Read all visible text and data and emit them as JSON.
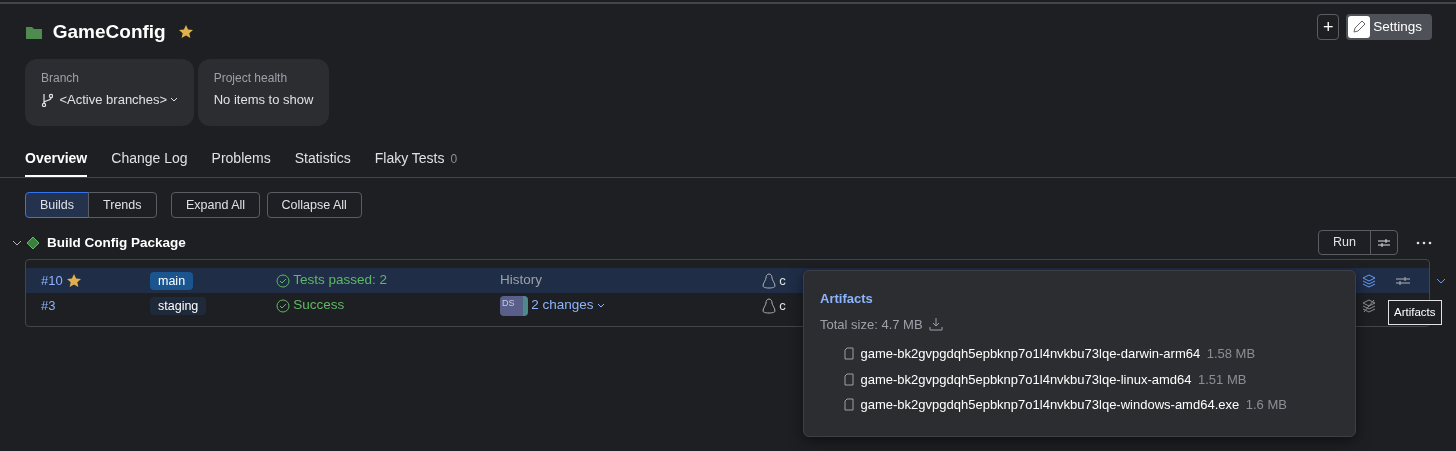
{
  "project": {
    "name": "GameConfig",
    "starred": true
  },
  "header_actions": {
    "add": "+",
    "settings": "Settings"
  },
  "cards": [
    {
      "kind": "dropdown",
      "label": "Branch",
      "value": "<Active branches>"
    },
    {
      "kind": "text",
      "label": "Project health",
      "value": "No items to show"
    }
  ],
  "tabs": [
    {
      "label": "Overview",
      "selected": true
    },
    {
      "label": "Change Log",
      "selected": false
    },
    {
      "label": "Problems",
      "selected": false
    },
    {
      "label": "Statistics",
      "selected": false
    },
    {
      "label": "Flaky Tests",
      "selected": false,
      "count": "0"
    }
  ],
  "view_toggle": [
    {
      "label": "Builds",
      "selected": true
    },
    {
      "label": "Trends",
      "selected": false
    }
  ],
  "toolbar_buttons": [
    "Expand All",
    "Collapse All"
  ],
  "build_config": {
    "name": "Build Config Package",
    "expanded": true,
    "run_label": "Run",
    "builds": [
      {
        "number": "#10",
        "starred": true,
        "selected": true,
        "branch": "main",
        "status": "Tests passed: 2",
        "changes": {
          "kind": "text",
          "text": "History"
        },
        "agent": "c"
      },
      {
        "number": "#3",
        "starred": false,
        "selected": false,
        "branch": "staging",
        "status": "Success",
        "changes": {
          "kind": "avatar",
          "avatar": "DS",
          "text": "2 changes"
        },
        "agent": "c"
      }
    ]
  },
  "artifacts_popover": {
    "title": "Artifacts",
    "total": "Total size: 4.7 MB",
    "files": [
      {
        "name": "game-bk2gvpgdqh5epbknp7o1l4nvkbu73lqe-darwin-arm64",
        "size": "1.58 MB"
      },
      {
        "name": "game-bk2gvpgdqh5epbknp7o1l4nvkbu73lqe-linux-amd64",
        "size": "1.51 MB"
      },
      {
        "name": "game-bk2gvpgdqh5epbknp7o1l4nvkbu73lqe-windows-amd64.exe",
        "size": "1.6 MB"
      }
    ]
  },
  "tooltip": "Artifacts"
}
